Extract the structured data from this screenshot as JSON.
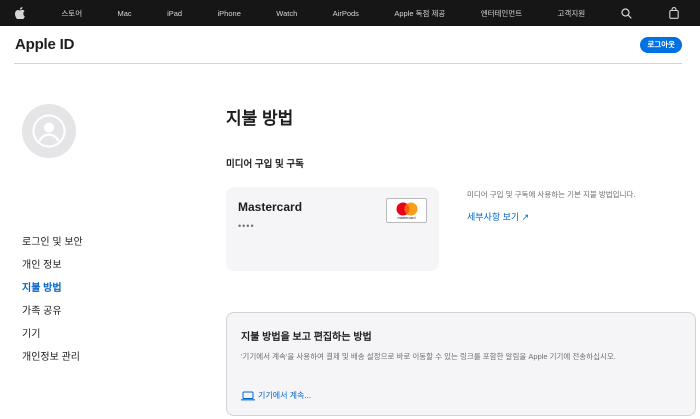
{
  "global_nav": {
    "items": [
      "스토어",
      "Mac",
      "iPad",
      "iPhone",
      "Watch",
      "AirPods",
      "Apple 독점 제공",
      "엔터테인먼트",
      "고객지원"
    ],
    "icons": [
      "apple-logo",
      "search-icon",
      "bag-icon"
    ]
  },
  "header": {
    "title": "Apple ID",
    "logout_label": "로그아웃"
  },
  "sidebar": {
    "items": [
      {
        "label": "로그인 및 보안",
        "active": false
      },
      {
        "label": "개인 정보",
        "active": false
      },
      {
        "label": "지불 방법",
        "active": true
      },
      {
        "label": "가족 공유",
        "active": false
      },
      {
        "label": "기기",
        "active": false
      },
      {
        "label": "개인정보 관리",
        "active": false
      }
    ]
  },
  "main": {
    "title": "지불 방법",
    "section_title": "미디어 구입 및 구독",
    "card": {
      "name": "Mastercard",
      "masked": "••••",
      "logo_label": "mastercard"
    },
    "description": "미디어 구입 및 구독에 사용하는 기본 지불 방법입니다.",
    "details_link": "세부사항 보기 ↗",
    "info_box": {
      "title": "지불 방법을 보고 편집하는 방법",
      "body": "'기기에서 계속'을 사용하여 결제 및 배송 설정으로 바로 이동할 수 있는 링크를 포함한 알림을 Apple 기기에 전송하십시오.",
      "link": "기기에서 계속..."
    }
  },
  "colors": {
    "nav_bg": "#161617",
    "accent": "#0071e3",
    "link": "#0066cc",
    "card_bg": "#f5f5f7"
  }
}
